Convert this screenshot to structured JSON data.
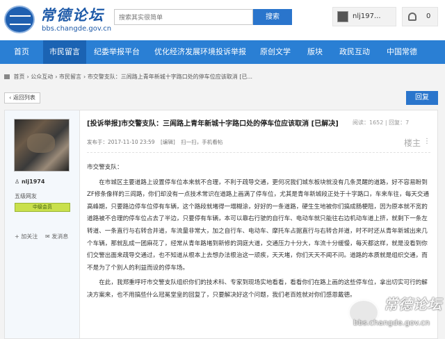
{
  "brand": {
    "title": "常德论坛",
    "url": "bbs.changde.gov.cn"
  },
  "header": {
    "search_placeholder": "搜索其实很简单",
    "search_button": "搜索",
    "username": "nlj197...",
    "notify_count": "0"
  },
  "nav": {
    "items": [
      "首页",
      "市民留言",
      "纪委举报平台",
      "优化经济发展环境投诉举报",
      "原创文学",
      "版块",
      "政民互动",
      "中国常德"
    ],
    "active": "市民留言"
  },
  "breadcrumb": [
    "首页",
    "公众互动",
    "市民留言",
    "市交警支队：三闾路上青年新城十字路口处的停车位应该取消 [已..."
  ],
  "back_button": "返回列表",
  "reply_button": "回复",
  "poster": {
    "name": "nlj1974",
    "level": "五级网友",
    "badge": "中级会员",
    "add_friend": "加关注",
    "message": "发消息"
  },
  "post": {
    "title": "[投诉举报]市交警支队：三闾路上青年新城十字路口处的停车位应该取消 [已解决]",
    "stats": "阅读：1652 | 回复：7",
    "meta": {
      "published": "发布于：2017-11-10 23:59",
      "source": "[编辑]",
      "scan": "扫一扫，手机看帖"
    },
    "floor": "楼主",
    "floor_icon": "⋮",
    "body": {
      "greeting": "市交警支队：",
      "para1": "在市城区主要道路上设置停车位本来就不合理，不利于疏导交通，更何况我们城东板块就没有几条灵醒的道路，好不容易盼到ZF修条像样的三闾路，你们却没有一点技术常识在道路上画满了停车位，尤其是青年新城段正处于十字路口，车来车往，每天交通高峰期，只要路边停车位停有车辆，这个路段就堵得一塌糊涂，好好的一条道路，硬生生地被你们搞成肠梗阻，因为原本就不宽的道路被不合理的停车位占去了半边，只要停有车辆，本可以靠右行驶的自行车、电动车就只能往右边机动车道上挤，就剩下一条左转道、一条直行与右转合并道，车流量非常大，加之自行车、电动车、摩托车占据直行与右转合并道，时不时还从青年新城出来几个车辆，那就乱成一团麻花了，经常从青年路堵到新修的洞庭大道，交通压力十分大，车流十分缓慢，每天都这样，就是没看到你们交警出面来疏导交通过，也不知道从根本上去想办法根治这一顽疾，天天堵，你们天天不闻不问。道路的本质就是组织交通，而不是为了个别人的利益而设的停车场。",
      "para2": "在此，我郑重呼吁市交警支队组织你们的技术科、专家到现场实地看看，看看你们在路上画的这些停车位，拿出切实可行的解决方案来，也不用搞些什么冠冕堂皇的回复了，只要解决好这个问题，我们老百姓就对你们感恩戴德。"
    }
  },
  "watermark": {
    "title": "常德论坛",
    "url": "bbs.changde.gov.cn"
  },
  "colors": {
    "nav_bg": "#2a7fd4",
    "nav_active": "#1b63b3",
    "button": "#2a75cc",
    "badge": "#c9e04c"
  }
}
